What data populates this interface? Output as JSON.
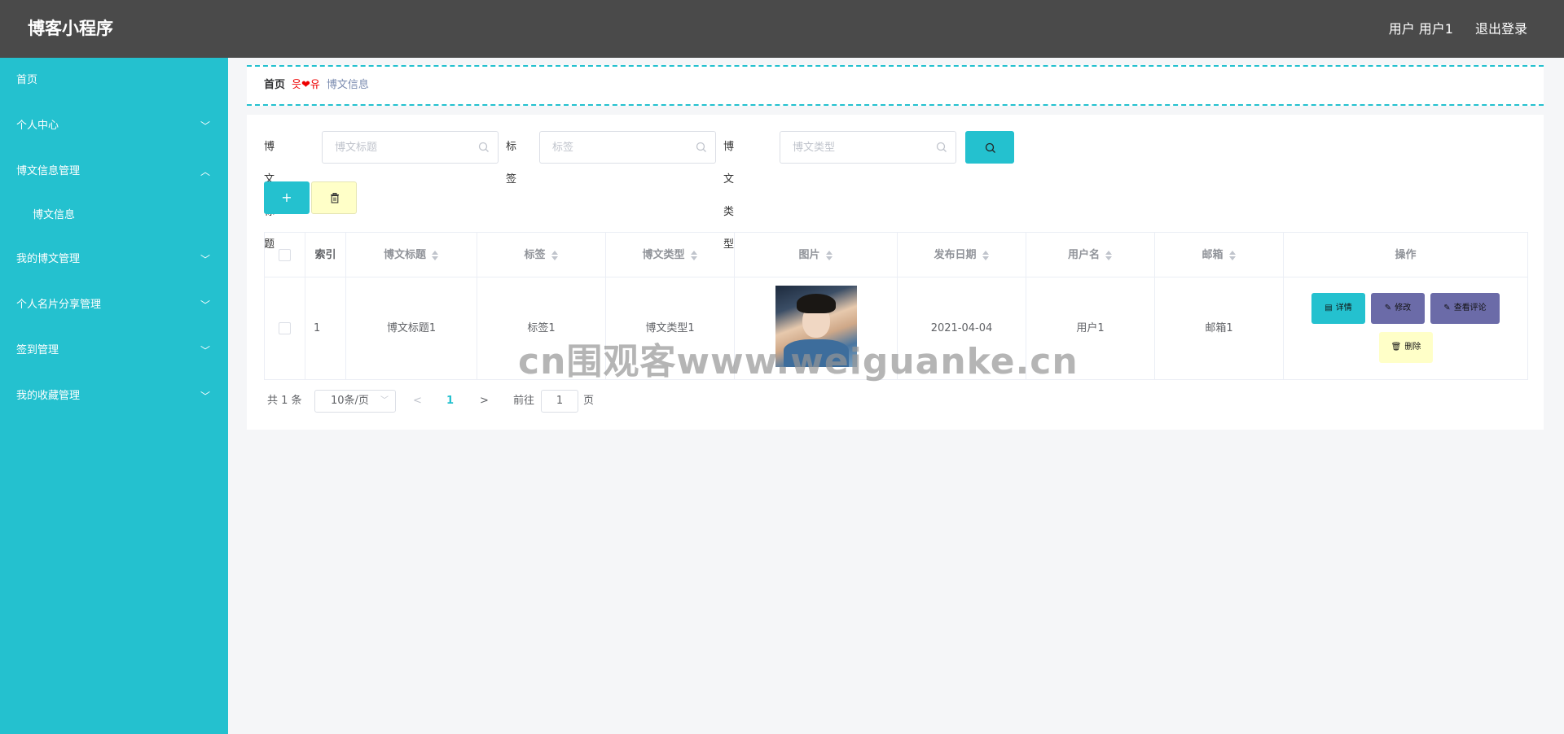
{
  "header": {
    "title": "博客小程序",
    "user": "用户 用户1",
    "logout": "退出登录"
  },
  "sidebar": {
    "items": [
      {
        "label": "首页",
        "chevron": ""
      },
      {
        "label": "个人中心",
        "chevron": "﹀"
      },
      {
        "label": "博文信息管理",
        "chevron": "︿"
      },
      {
        "label": "博文信息",
        "chevron": ""
      },
      {
        "label": "我的博文管理",
        "chevron": "﹀"
      },
      {
        "label": "个人名片分享管理",
        "chevron": "﹀"
      },
      {
        "label": "签到管理",
        "chevron": "﹀"
      },
      {
        "label": "我的收藏管理",
        "chevron": "﹀"
      }
    ]
  },
  "breadcrumb": {
    "home": "首页",
    "separator": "읏❤유",
    "current": "博文信息"
  },
  "search": {
    "title_label": "博文标题",
    "title_placeholder": "博文标题",
    "tag_label": "标签",
    "tag_placeholder": "标签",
    "type_label": "博文类型",
    "type_placeholder": "博文类型"
  },
  "actions": {
    "add_label": "+"
  },
  "table": {
    "headers": [
      "索引",
      "博文标题",
      "标签",
      "博文类型",
      "图片",
      "发布日期",
      "用户名",
      "邮箱",
      "操作"
    ],
    "rows": [
      {
        "index": "1",
        "title": "博文标题1",
        "tag": "标签1",
        "type": "博文类型1",
        "date": "2021-04-04",
        "username": "用户1",
        "email": "邮箱1"
      }
    ],
    "ops": {
      "detail": "详情",
      "edit": "修改",
      "comments": "查看评论",
      "delete": "删除"
    }
  },
  "pagination": {
    "total": "共 1 条",
    "page_size": "10条/页",
    "current_page": "1",
    "goto_prefix": "前往",
    "goto_value": "1",
    "goto_suffix": "页"
  },
  "watermark": "cn围观客www.weiguanke.cn",
  "colors": {
    "accent": "#24c1cf",
    "header_bg": "#4a4a4a",
    "edit_button": "#6b6ba8",
    "delete_button": "#ffffc8"
  }
}
